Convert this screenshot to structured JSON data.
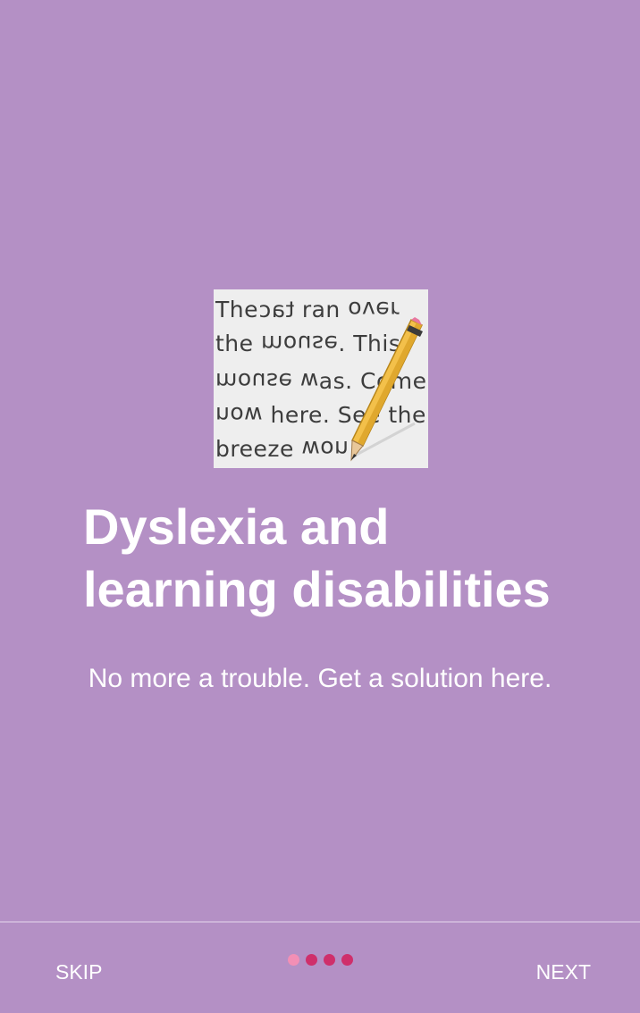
{
  "onboarding": {
    "illustration": {
      "lines": [
        {
          "a": "The",
          "b": "tac",
          "c": " ran  ",
          "d": "over"
        },
        {
          "a": "the ",
          "b": "mouse",
          "c": ". This",
          "d": ""
        },
        {
          "a": "",
          "b": "mouse w",
          "c": "as. Come",
          "d": ""
        },
        {
          "a": "",
          "b": "now",
          "c": " here. See the",
          "d": ""
        },
        {
          "a": "breeze ",
          "b": "won",
          "c": "",
          "d": ""
        }
      ],
      "pencil_icon": "pencil-icon"
    },
    "title_line_1": "Dyslexia and",
    "title_line_2": "learning disabilities",
    "subtitle": "No more a trouble. Get a solution here."
  },
  "footer": {
    "skip_label": "SKIP",
    "next_label": "NEXT",
    "page_indicator": {
      "total": 4,
      "current": 1
    }
  },
  "colors": {
    "background": "#b490c5",
    "text": "#ffffff",
    "dot_active": "#f28fb5",
    "dot_inactive": "#cf2f6b",
    "divider": "#cdb4d9"
  }
}
